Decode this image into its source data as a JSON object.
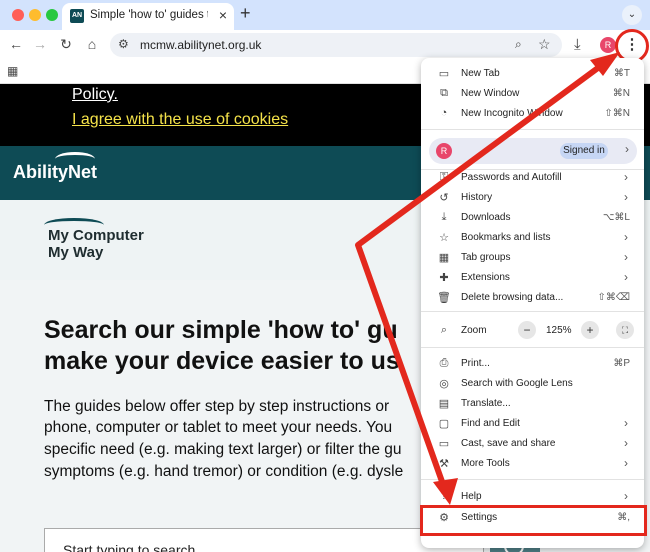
{
  "browser": {
    "tab": {
      "favicon_text": "AN",
      "title": "Simple 'how to' guides to mak",
      "close": "×"
    },
    "new_tab": "+",
    "tab_search": "⌄",
    "url": "mcmw.abilitynet.org.uk",
    "profile_initial": "R",
    "icons": {
      "back": "arrow-left-icon",
      "forward": "arrow-right-icon",
      "reload": "reload-icon",
      "home": "home-icon",
      "site_settings": "tune-icon",
      "zoom": "zoom-icon",
      "bookmark": "star-icon",
      "download": "download-icon",
      "menu": "kebab-icon",
      "apps": "apps-grid-icon"
    },
    "highlight_color": "#e3281d"
  },
  "page": {
    "cookie": {
      "policy_text": "Policy.",
      "agree_text": "I agree with the use of cookies"
    },
    "brand": {
      "logo": "AbilityNet"
    },
    "mcmw": {
      "line1": "My Computer",
      "line2": "My Way"
    },
    "headline": {
      "line1": "Search our simple 'how to' gu",
      "line2": "make your device easier to us"
    },
    "paragraph": [
      "The guides below offer step by step instructions or",
      "phone, computer or tablet to meet your needs. You",
      "specific need (e.g. making text larger) or filter the gu",
      "symptoms (e.g. hand tremor) or condition (e.g. dysle"
    ],
    "search_placeholder": "Start typing to search",
    "colors": {
      "brand_teal": "#0e4b55",
      "cookie_link": "#f5e34a"
    }
  },
  "menu": {
    "items": [
      {
        "label": "New Tab",
        "shortcut": "⌘T",
        "icon": "new-tab-icon"
      },
      {
        "label": "New Window",
        "shortcut": "⌘N",
        "icon": "new-window-icon"
      },
      {
        "label": "New Incognito Window",
        "shortcut": "⇧⌘N",
        "icon": "incognito-icon"
      },
      {
        "label": "Passwords and Autofill",
        "shortcut": "",
        "icon": "key-icon"
      },
      {
        "label": "History",
        "shortcut": "",
        "icon": "history-icon"
      },
      {
        "label": "Downloads",
        "shortcut": "⌥⌘L",
        "icon": "download-icon"
      },
      {
        "label": "Bookmarks and lists",
        "shortcut": "",
        "icon": "star-icon"
      },
      {
        "label": "Tab groups",
        "shortcut": "",
        "icon": "tab-groups-icon"
      },
      {
        "label": "Extensions",
        "shortcut": "",
        "icon": "puzzle-icon"
      },
      {
        "label": "Delete browsing data...",
        "shortcut": "⇧⌘⌫",
        "icon": "trash-icon"
      },
      {
        "label": "Print...",
        "shortcut": "⌘P",
        "icon": "print-icon"
      },
      {
        "label": "Search with Google Lens",
        "shortcut": "",
        "icon": "lens-icon"
      },
      {
        "label": "Translate...",
        "shortcut": "",
        "icon": "translate-icon"
      },
      {
        "label": "Find and Edit",
        "shortcut": "",
        "icon": "find-icon"
      },
      {
        "label": "Cast, save and share",
        "shortcut": "",
        "icon": "cast-icon"
      },
      {
        "label": "More Tools",
        "shortcut": "",
        "icon": "tools-icon"
      },
      {
        "label": "Help",
        "shortcut": "",
        "icon": "help-icon"
      },
      {
        "label": "Settings",
        "shortcut": "⌘,",
        "icon": "gear-icon"
      }
    ],
    "profile": {
      "initial": "R",
      "status": "Signed in"
    },
    "zoom": {
      "label": "Zoom",
      "minus": "−",
      "value": "125%",
      "plus": "+"
    }
  }
}
